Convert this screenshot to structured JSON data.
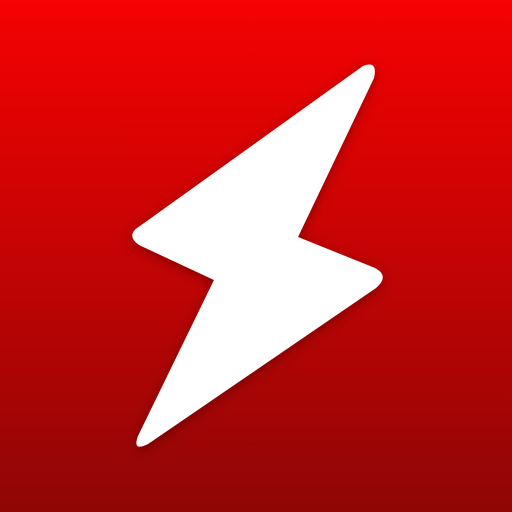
{
  "app_icon": {
    "icon": "lightning-bolt-icon",
    "colors": {
      "background_top": "#f50202",
      "background_mid": "#c90303",
      "background_bottom": "#8f0606",
      "bolt": "#ffffff"
    }
  }
}
